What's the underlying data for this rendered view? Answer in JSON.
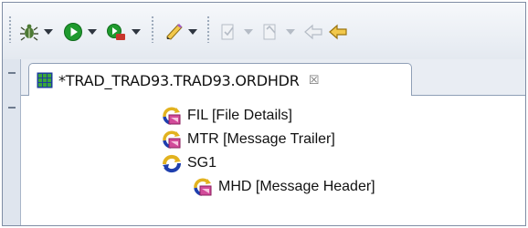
{
  "editor": {
    "tab_title": "*TRAD_TRAD93.TRAD93.ORDHDR",
    "close_symbol": "☒"
  },
  "tree": {
    "items": [
      {
        "label": "FIL [File Details]",
        "icon": "segment-icon"
      },
      {
        "label": "MTR [Message Trailer]",
        "icon": "segment-icon"
      },
      {
        "label": "SG1",
        "icon": "group-loop-icon"
      },
      {
        "label": "MHD [Message Header]",
        "icon": "segment-icon"
      }
    ]
  },
  "colors": {
    "toolbar_green": "#1f9a2e",
    "icon_gold": "#e2b21f",
    "icon_blue": "#1e3fae",
    "icon_pink": "#d24b9a",
    "grid_blue": "#1c3f9b",
    "grid_green": "#3aa53a"
  }
}
